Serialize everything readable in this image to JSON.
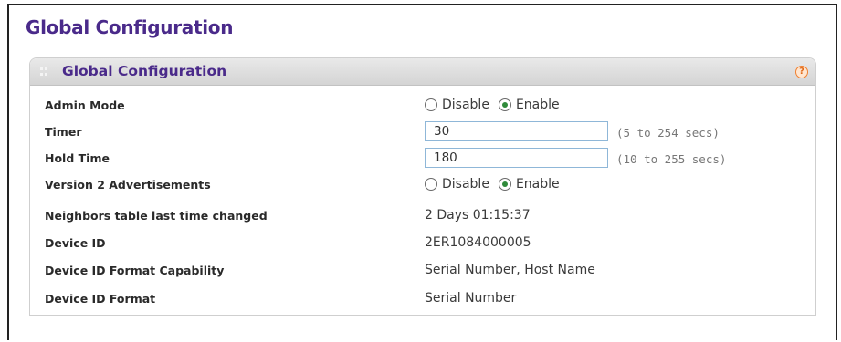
{
  "page": {
    "title": "Global Configuration"
  },
  "panel": {
    "title": "Global Configuration",
    "help_icon": "help-icon"
  },
  "colors": {
    "title": "#4a2a8a",
    "radio_checked": "#2f8a3a",
    "help": "#f08030"
  },
  "fields": {
    "admin_mode": {
      "label": "Admin Mode",
      "options": [
        "Disable",
        "Enable"
      ],
      "selected": "Enable"
    },
    "timer": {
      "label": "Timer",
      "value": "30",
      "range": "(5 to 254 secs)"
    },
    "hold_time": {
      "label": "Hold Time",
      "value": "180",
      "range": "(10 to 255 secs)"
    },
    "version2": {
      "label": "Version 2 Advertisements",
      "options": [
        "Disable",
        "Enable"
      ],
      "selected": "Enable"
    },
    "neighbors_changed": {
      "label": "Neighbors table last time changed",
      "value": "2 Days 01:15:37"
    },
    "device_id": {
      "label": "Device ID",
      "value": "2ER1084000005"
    },
    "device_id_format_capability": {
      "label": "Device ID Format Capability",
      "value": "Serial Number, Host Name"
    },
    "device_id_format": {
      "label": "Device ID Format",
      "value": "Serial Number"
    }
  }
}
